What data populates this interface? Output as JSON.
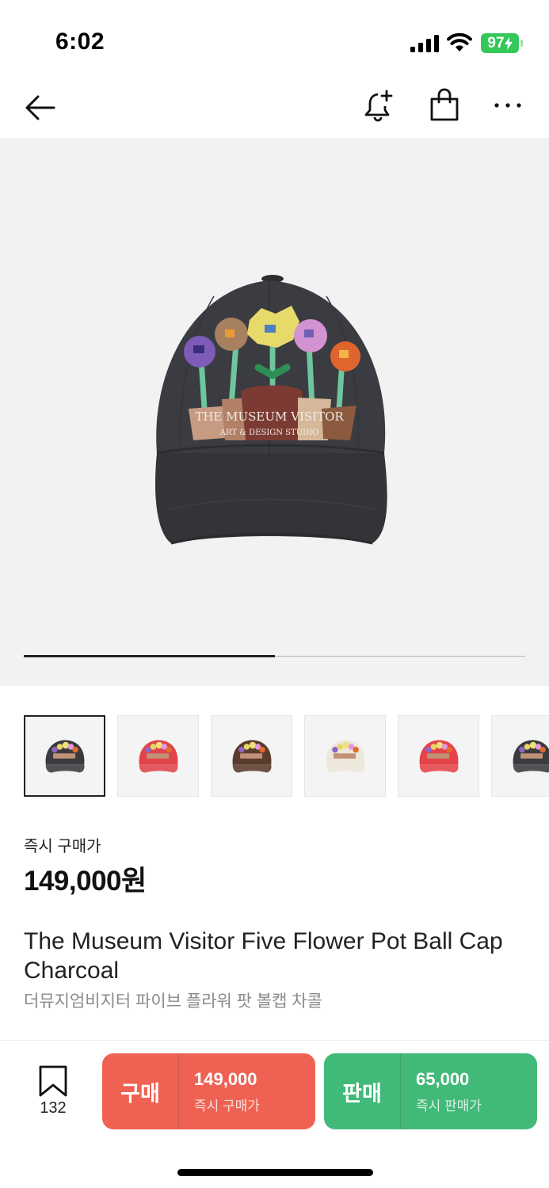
{
  "status_bar": {
    "time": "6:02",
    "battery": "97"
  },
  "nav": {
    "back_icon": "arrow-left-icon",
    "alert_icon": "bell-plus-icon",
    "bag_icon": "shopping-bag-icon",
    "more_icon": "more-horizontal-icon"
  },
  "gallery": {
    "progress": 0.5,
    "thumbnails": [
      {
        "variant": "charcoal",
        "color": "#3a3b3f",
        "selected": true
      },
      {
        "variant": "red",
        "color": "#e0434a",
        "selected": false
      },
      {
        "variant": "brown",
        "color": "#5a3b2c",
        "selected": false
      },
      {
        "variant": "cream",
        "color": "#ede7dc",
        "selected": false
      },
      {
        "variant": "red",
        "color": "#e5434a",
        "selected": false
      },
      {
        "variant": "charcoal",
        "color": "#3a3b3f",
        "selected": false
      }
    ]
  },
  "price": {
    "label": "즉시 구매가",
    "value": "149,000원"
  },
  "product": {
    "title": "The Museum Visitor Five Flower Pot Ball Cap Charcoal",
    "subtitle": "더뮤지엄비지터 파이브 플라워 팟 볼캡 차콜",
    "embroidery_line1": "THE MUSEUM VISITOR",
    "embroidery_line2": "ART & DESIGN STUDIO"
  },
  "bottom_bar": {
    "wish_icon": "bookmark-icon",
    "wish_count": "132",
    "buy": {
      "label": "구매",
      "price": "149,000",
      "sub": "즉시 구매가",
      "color": "#ef6253"
    },
    "sell": {
      "label": "판매",
      "price": "65,000",
      "sub": "즉시 판매가",
      "color": "#41b979"
    }
  }
}
